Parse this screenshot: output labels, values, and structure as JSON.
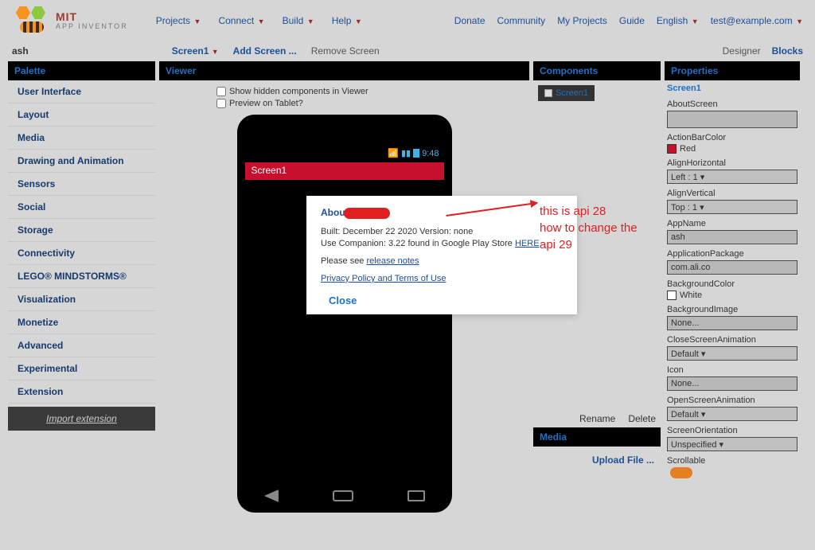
{
  "logo": {
    "title": "MIT",
    "subtitle": "APP INVENTOR"
  },
  "menu_left": [
    {
      "label": "Projects",
      "caret": true
    },
    {
      "label": "Connect",
      "caret": true
    },
    {
      "label": "Build",
      "caret": true
    },
    {
      "label": "Help",
      "caret": true
    }
  ],
  "menu_right": [
    {
      "label": "Donate"
    },
    {
      "label": "Community"
    },
    {
      "label": "My Projects"
    },
    {
      "label": "Guide"
    },
    {
      "label": "English",
      "caret": true
    },
    {
      "label": "test@example.com",
      "caret": true
    }
  ],
  "project_name": "ash",
  "subbar": {
    "screen": "Screen1",
    "add": "Add Screen ...",
    "remove": "Remove Screen",
    "designer": "Designer",
    "blocks": "Blocks"
  },
  "palette": {
    "title": "Palette",
    "items": [
      "User Interface",
      "Layout",
      "Media",
      "Drawing and Animation",
      "Sensors",
      "Social",
      "Storage",
      "Connectivity",
      "LEGO® MINDSTORMS®",
      "Visualization",
      "Monetize",
      "Advanced",
      "Experimental",
      "Extension"
    ],
    "import": "Import extension"
  },
  "viewer": {
    "title": "Viewer",
    "show_hidden": "Show hidden components in Viewer",
    "preview_tablet": "Preview on Tablet?",
    "statusbar_time": "9:48",
    "appbar": "Screen1"
  },
  "dialog": {
    "title_prefix": "Abou",
    "built": "Built: December 22 2020 Version: none",
    "companion": "Use Companion: 3.22 found in Google Play Store ",
    "here": "HERE",
    "please": "Please see ",
    "release": "release notes",
    "privacy": "Privacy Policy and Terms of Use",
    "close": "Close"
  },
  "annotation": {
    "l1": "this is api 28",
    "l2": "how to change the",
    "l3": "api 29"
  },
  "components": {
    "title": "Components",
    "root": "Screen1",
    "rename": "Rename",
    "delete": "Delete",
    "media": "Media",
    "upload": "Upload File ..."
  },
  "properties": {
    "title": "Properties",
    "screen": "Screen1",
    "items": [
      {
        "label": "AboutScreen",
        "type": "textarea",
        "value": ""
      },
      {
        "label": "ActionBarColor",
        "type": "color",
        "swatch": "#c8102e",
        "value": "Red"
      },
      {
        "label": "AlignHorizontal",
        "type": "select",
        "value": "Left : 1"
      },
      {
        "label": "AlignVertical",
        "type": "select",
        "value": "Top : 1"
      },
      {
        "label": "AppName",
        "type": "input",
        "value": "ash"
      },
      {
        "label": "ApplicationPackage",
        "type": "input",
        "value": "com.ali.co"
      },
      {
        "label": "BackgroundColor",
        "type": "color",
        "swatch": "#ffffff",
        "value": "White"
      },
      {
        "label": "BackgroundImage",
        "type": "input",
        "value": "None..."
      },
      {
        "label": "CloseScreenAnimation",
        "type": "select",
        "value": "Default"
      },
      {
        "label": "Icon",
        "type": "input",
        "value": "None..."
      },
      {
        "label": "OpenScreenAnimation",
        "type": "select",
        "value": "Default"
      },
      {
        "label": "ScreenOrientation",
        "type": "select",
        "value": "Unspecified"
      },
      {
        "label": "Scrollable",
        "type": "toggle",
        "value": ""
      }
    ]
  }
}
